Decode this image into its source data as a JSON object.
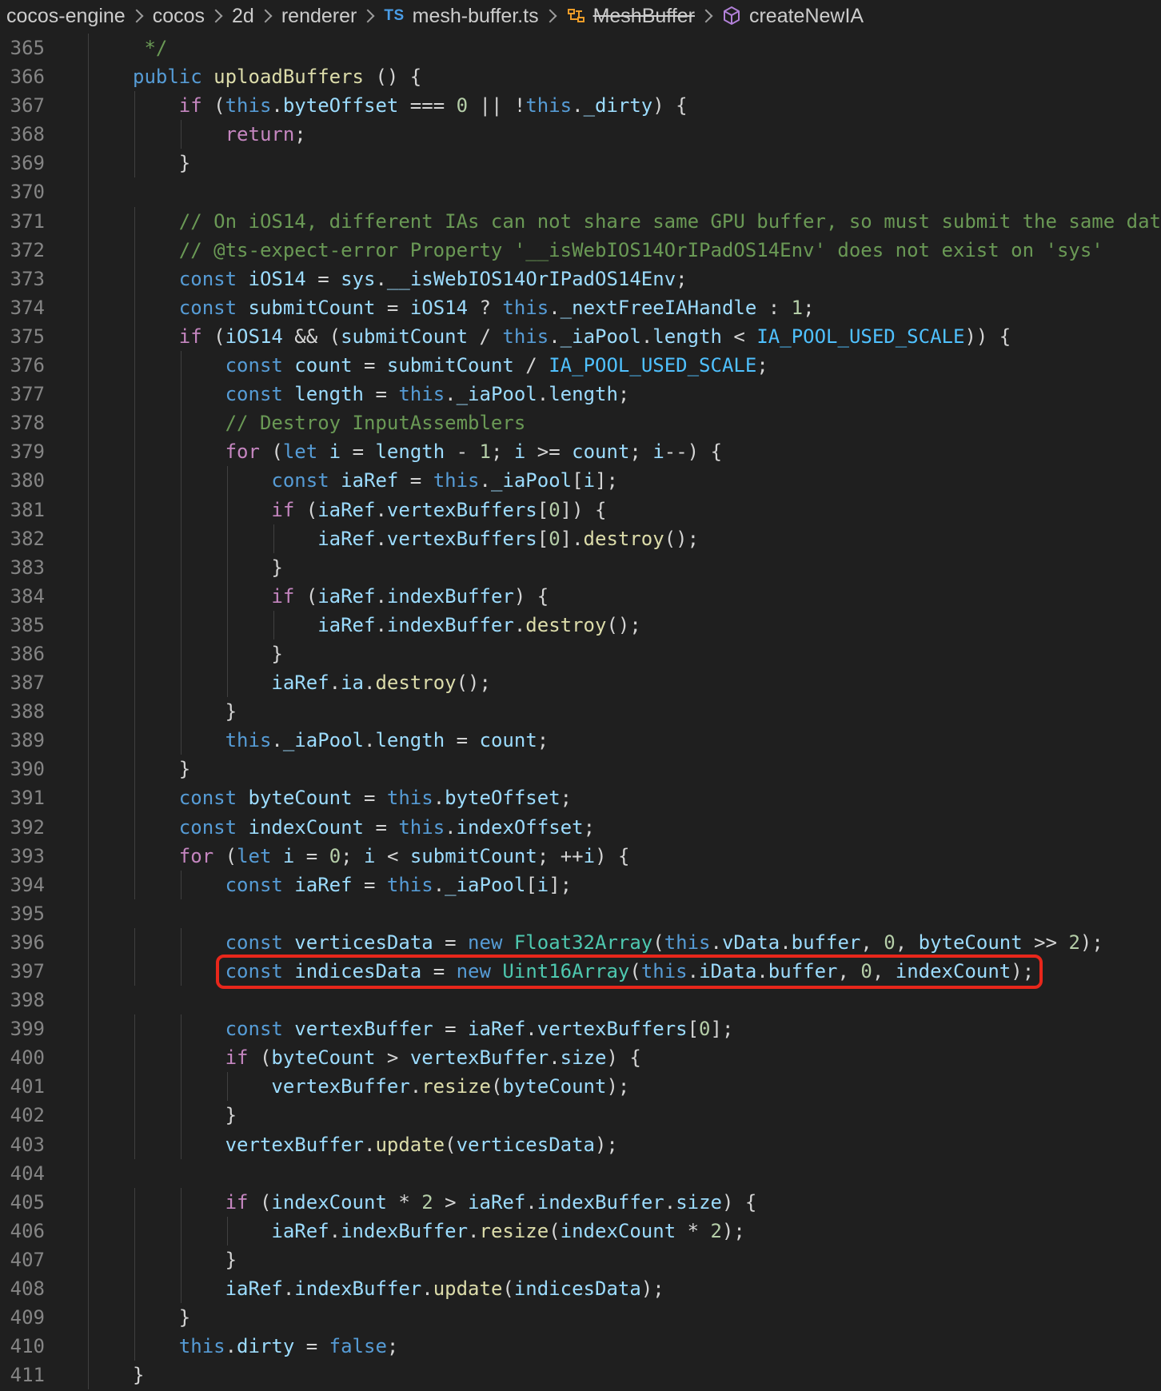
{
  "breadcrumb": {
    "items": [
      "cocos-engine",
      "cocos",
      "2d",
      "renderer"
    ],
    "file_badge": "TS",
    "file": "mesh-buffer.ts",
    "class_name": "MeshBuffer",
    "method": "createNewIA",
    "icons": [
      "chevron-right-icon",
      "typescript-file-icon",
      "class-icon",
      "method-cube-icon"
    ]
  },
  "colors": {
    "background": "#1f1f1f",
    "keyword": "#569cd6",
    "control": "#c586c0",
    "function": "#dcdcaa",
    "variable": "#9cdcfe",
    "constant": "#4fc1ff",
    "type": "#4ec9b0",
    "number": "#b5cea8",
    "string": "#ce9178",
    "comment": "#6a9955",
    "line_number": "#858585",
    "highlight_box": "#e8271b"
  },
  "highlighted_line": 397,
  "code_lines": [
    {
      "n": "365",
      "text": " */"
    },
    {
      "n": "366",
      "text": "public uploadBuffers () {"
    },
    {
      "n": "367",
      "text": "    if (this.byteOffset === 0 || !this._dirty) {"
    },
    {
      "n": "368",
      "text": "        return;"
    },
    {
      "n": "369",
      "text": "    }"
    },
    {
      "n": "370",
      "text": ""
    },
    {
      "n": "371",
      "text": "    // On iOS14, different IAs can not share same GPU buffer, so must submit the same dat"
    },
    {
      "n": "372",
      "text": "    // @ts-expect-error Property '__isWebIOS14OrIPadOS14Env' does not exist on 'sys'"
    },
    {
      "n": "373",
      "text": "    const iOS14 = sys.__isWebIOS14OrIPadOS14Env;"
    },
    {
      "n": "374",
      "text": "    const submitCount = iOS14 ? this._nextFreeIAHandle : 1;"
    },
    {
      "n": "375",
      "text": "    if (iOS14 && (submitCount / this._iaPool.length < IA_POOL_USED_SCALE)) {"
    },
    {
      "n": "376",
      "text": "        const count = submitCount / IA_POOL_USED_SCALE;"
    },
    {
      "n": "377",
      "text": "        const length = this._iaPool.length;"
    },
    {
      "n": "378",
      "text": "        // Destroy InputAssemblers"
    },
    {
      "n": "379",
      "text": "        for (let i = length - 1; i >= count; i--) {"
    },
    {
      "n": "380",
      "text": "            const iaRef = this._iaPool[i];"
    },
    {
      "n": "381",
      "text": "            if (iaRef.vertexBuffers[0]) {"
    },
    {
      "n": "382",
      "text": "                iaRef.vertexBuffers[0].destroy();"
    },
    {
      "n": "383",
      "text": "            }"
    },
    {
      "n": "384",
      "text": "            if (iaRef.indexBuffer) {"
    },
    {
      "n": "385",
      "text": "                iaRef.indexBuffer.destroy();"
    },
    {
      "n": "386",
      "text": "            }"
    },
    {
      "n": "387",
      "text": "            iaRef.ia.destroy();"
    },
    {
      "n": "388",
      "text": "        }"
    },
    {
      "n": "389",
      "text": "        this._iaPool.length = count;"
    },
    {
      "n": "390",
      "text": "    }"
    },
    {
      "n": "391",
      "text": "    const byteCount = this.byteOffset;"
    },
    {
      "n": "392",
      "text": "    const indexCount = this.indexOffset;"
    },
    {
      "n": "393",
      "text": "    for (let i = 0; i < submitCount; ++i) {"
    },
    {
      "n": "394",
      "text": "        const iaRef = this._iaPool[i];"
    },
    {
      "n": "395",
      "text": ""
    },
    {
      "n": "396",
      "text": "        const verticesData = new Float32Array(this.vData.buffer, 0, byteCount >> 2);"
    },
    {
      "n": "397",
      "text": "        const indicesData = new Uint16Array(this.iData.buffer, 0, indexCount);"
    },
    {
      "n": "398",
      "text": ""
    },
    {
      "n": "399",
      "text": "        const vertexBuffer = iaRef.vertexBuffers[0];"
    },
    {
      "n": "400",
      "text": "        if (byteCount > vertexBuffer.size) {"
    },
    {
      "n": "401",
      "text": "            vertexBuffer.resize(byteCount);"
    },
    {
      "n": "402",
      "text": "        }"
    },
    {
      "n": "403",
      "text": "        vertexBuffer.update(verticesData);"
    },
    {
      "n": "404",
      "text": ""
    },
    {
      "n": "405",
      "text": "        if (indexCount * 2 > iaRef.indexBuffer.size) {"
    },
    {
      "n": "406",
      "text": "            iaRef.indexBuffer.resize(indexCount * 2);"
    },
    {
      "n": "407",
      "text": "        }"
    },
    {
      "n": "408",
      "text": "        iaRef.indexBuffer.update(indicesData);"
    },
    {
      "n": "409",
      "text": "    }"
    },
    {
      "n": "410",
      "text": "    this.dirty = false;"
    },
    {
      "n": "411",
      "text": "}"
    }
  ]
}
